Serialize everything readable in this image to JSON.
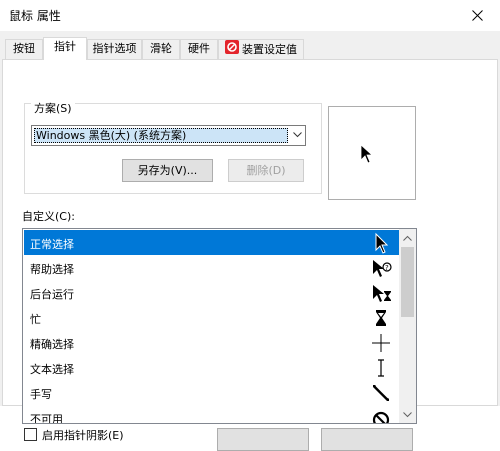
{
  "window": {
    "title": "鼠标 属性"
  },
  "tabs": [
    {
      "label": "按钮"
    },
    {
      "label": "指针"
    },
    {
      "label": "指针选项"
    },
    {
      "label": "滑轮"
    },
    {
      "label": "硬件"
    },
    {
      "label": "装置设定值"
    }
  ],
  "scheme": {
    "group_label": "方案(S)",
    "selected": "Windows 黑色(大) (系统方案)",
    "save_as_label": "另存为(V)...",
    "delete_label": "删除(D)"
  },
  "customize": {
    "label": "自定义(C):",
    "items": [
      {
        "label": "正常选择",
        "cursor": "arrow-cursor-icon"
      },
      {
        "label": "帮助选择",
        "cursor": "help-cursor-icon"
      },
      {
        "label": "后台运行",
        "cursor": "working-cursor-icon"
      },
      {
        "label": "忙",
        "cursor": "busy-cursor-icon"
      },
      {
        "label": "精确选择",
        "cursor": "crosshair-cursor-icon"
      },
      {
        "label": "文本选择",
        "cursor": "text-cursor-icon"
      },
      {
        "label": "手写",
        "cursor": "pen-cursor-icon"
      },
      {
        "label": "不可用",
        "cursor": "unavailable-cursor-icon"
      }
    ],
    "selected_index": 0
  },
  "options": {
    "shadow_label": "启用指针阴影(E)"
  },
  "colors": {
    "selection": "#0078d7",
    "tab_border": "#d9d9d9",
    "app_icon_red": "#e3242b"
  }
}
